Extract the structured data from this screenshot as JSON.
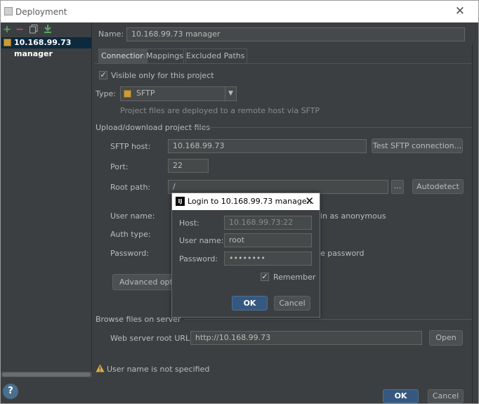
{
  "window": {
    "title": "Deployment"
  },
  "sidebar": {
    "server_name": "10.168.99.73 manager"
  },
  "form": {
    "name_label": "Name:",
    "name_value": "10.168.99.73 manager",
    "tabs": [
      {
        "label": "Connection",
        "active": true
      },
      {
        "label": "Mappings",
        "active": false
      },
      {
        "label": "Excluded Paths",
        "active": false
      }
    ],
    "visible_only_label": "Visible only for this project",
    "type_label": "Type:",
    "type_value": "SFTP",
    "type_hint": "Project files are deployed to a remote host via SFTP",
    "section_upload": "Upload/download project files",
    "sftp_host_label": "SFTP host:",
    "sftp_host_value": "10.168.99.73",
    "test_button": "Test SFTP connection...",
    "port_label": "Port:",
    "port_value": "22",
    "root_path_label": "Root path:",
    "root_path_value": "/",
    "browse_button": "...",
    "autodetect_button": "Autodetect",
    "user_name_label": "User name:",
    "anonymous_label": "in as anonymous",
    "auth_type_label": "Auth type:",
    "password_label": "Password:",
    "save_password_label": "e password",
    "advanced_button": "Advanced optio",
    "section_browse": "Browse files on server",
    "web_root_label": "Web server root URL:",
    "web_root_value": "http://10.168.99.73",
    "open_button": "Open",
    "warning_text": "User name is not specified",
    "ok_button": "OK",
    "cancel_button": "Cancel",
    "help_button": "?"
  },
  "login": {
    "title": "Login to 10.168.99.73 manage...",
    "host_label": "Host:",
    "host_value": "10.168.99.73:22",
    "user_label": "User name:",
    "user_value": "root",
    "password_label": "Password:",
    "password_value": "••••••••",
    "remember_label": "Remember",
    "ok_button": "OK",
    "cancel_button": "Cancel"
  },
  "colors": {
    "accent": "#365880",
    "background": "#3c3f41",
    "selection": "#0d293e",
    "warning": "#e0b040"
  }
}
